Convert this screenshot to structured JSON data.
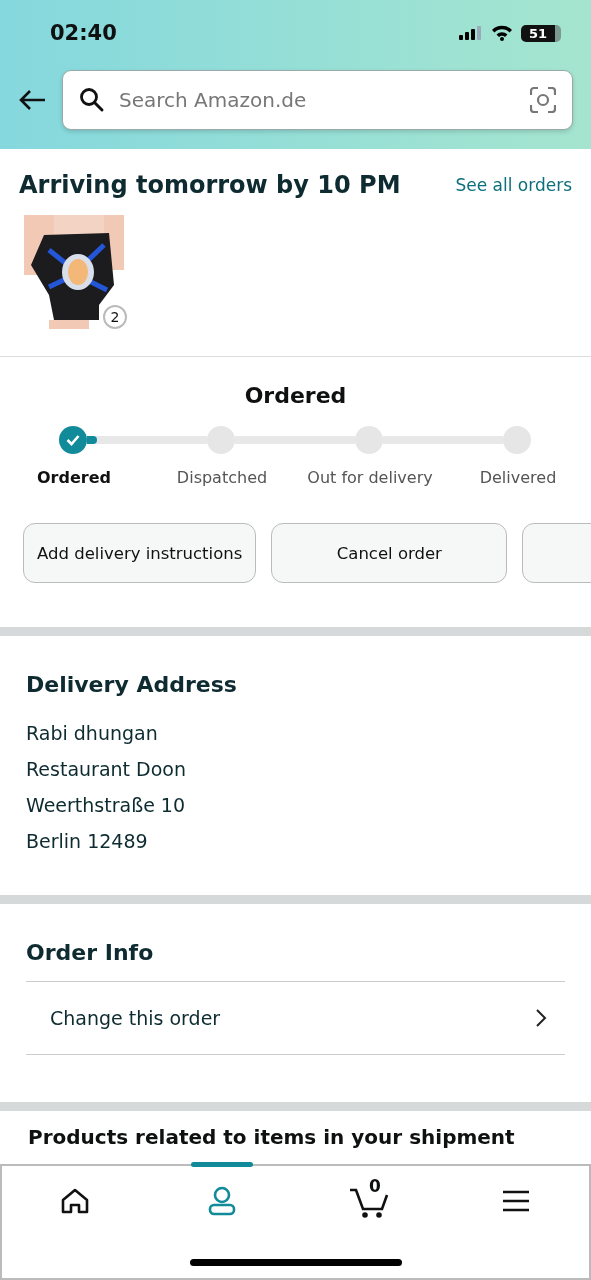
{
  "status_bar": {
    "time": "02:40",
    "battery": "51"
  },
  "search": {
    "placeholder": "Search Amazon.de"
  },
  "shipment": {
    "title": "Arriving tomorrow by 10 PM",
    "link": "See all orders",
    "item_count": "2"
  },
  "tracker": {
    "status": "Ordered",
    "steps": [
      {
        "label": "Ordered",
        "done": true,
        "selected": true
      },
      {
        "label": "Dispatched",
        "done": false,
        "selected": false
      },
      {
        "label": "Out for delivery",
        "done": false,
        "selected": false
      },
      {
        "label": "Delivered",
        "done": false,
        "selected": false
      }
    ]
  },
  "actions": [
    "Add delivery instructions",
    "Cancel order"
  ],
  "delivery_address": {
    "title": "Delivery Address",
    "lines": [
      "Rabi dhungan",
      "Restaurant Doon",
      "Weerthstraße 10",
      "Berlin 12489"
    ]
  },
  "order_info": {
    "title": "Order Info",
    "items": [
      "Change this order"
    ]
  },
  "related": {
    "title": "Products related to items in your shipment"
  },
  "bottom_nav": [
    {
      "kind": "home",
      "selected": false
    },
    {
      "kind": "account",
      "selected": true
    },
    {
      "kind": "cart",
      "selected": false,
      "count": "0"
    },
    {
      "kind": "menu",
      "selected": false
    }
  ]
}
